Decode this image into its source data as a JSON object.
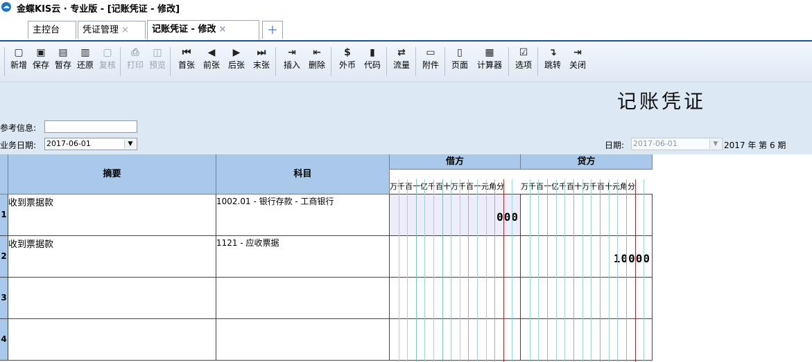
{
  "window": {
    "title": "金蝶KIS云 · 专业版 - [记账凭证 - 修改]"
  },
  "tabs": [
    {
      "label": "主控台",
      "closable": false
    },
    {
      "label": "凭证管理",
      "closable": true
    },
    {
      "label": "记账凭证 - 修改",
      "closable": true,
      "active": true
    }
  ],
  "tab_close_glyph": "×",
  "tab_add_glyph": "＋",
  "toolbar": [
    {
      "label": "新增",
      "icon": "new-icon",
      "glyph": "▢",
      "enabled": true
    },
    {
      "label": "保存",
      "icon": "save-icon",
      "glyph": "▣",
      "enabled": true
    },
    {
      "label": "暂存",
      "icon": "hold-icon",
      "glyph": "▤",
      "enabled": true
    },
    {
      "label": "还原",
      "icon": "restore-icon",
      "glyph": "▥",
      "enabled": true
    },
    {
      "label": "复核",
      "icon": "review-icon",
      "glyph": "▢",
      "enabled": false
    },
    {
      "label": "打印",
      "icon": "print-icon",
      "glyph": "⎙",
      "enabled": false
    },
    {
      "label": "预览",
      "icon": "preview-icon",
      "glyph": "◫",
      "enabled": false
    },
    {
      "label": "首张",
      "icon": "first-icon",
      "glyph": "⏮",
      "enabled": true
    },
    {
      "label": "前张",
      "icon": "prev-icon",
      "glyph": "◀",
      "enabled": true
    },
    {
      "label": "后张",
      "icon": "next-icon",
      "glyph": "▶",
      "enabled": true
    },
    {
      "label": "末张",
      "icon": "last-icon",
      "glyph": "⏭",
      "enabled": true
    },
    {
      "label": "插入",
      "icon": "insert-row-icon",
      "glyph": "⇥",
      "enabled": true
    },
    {
      "label": "删除",
      "icon": "delete-row-icon",
      "glyph": "⇤",
      "enabled": true
    },
    {
      "label": "外币",
      "icon": "currency-icon",
      "glyph": "$",
      "enabled": true
    },
    {
      "label": "代码",
      "icon": "code-icon",
      "glyph": "▮",
      "enabled": true
    },
    {
      "label": "流量",
      "icon": "cashflow-icon",
      "glyph": "⇄",
      "enabled": true
    },
    {
      "label": "附件",
      "icon": "attachment-icon",
      "glyph": "▭",
      "enabled": true
    },
    {
      "label": "页面",
      "icon": "page-icon",
      "glyph": "▯",
      "enabled": true
    },
    {
      "label": "计算器",
      "icon": "calculator-icon",
      "glyph": "▦",
      "enabled": true
    },
    {
      "label": "选项",
      "icon": "options-icon",
      "glyph": "☑",
      "enabled": true
    },
    {
      "label": "跳转",
      "icon": "jump-icon",
      "glyph": "↴",
      "enabled": true
    },
    {
      "label": "关闭",
      "icon": "close-icon",
      "glyph": "⇥",
      "enabled": true
    }
  ],
  "header": {
    "voucher_title": "记账凭证",
    "ref_label": "参考信息:",
    "ref_value": "",
    "biz_date_label": "业务日期:",
    "biz_date_value": "2017-06-01",
    "date_label": "日期:",
    "date_value": "2017-06-01",
    "period_text": "2017 年 第 6 期"
  },
  "grid": {
    "col_summary": "摘要",
    "col_account": "科目",
    "col_debit": "借方",
    "col_credit": "贷方",
    "digit_units": "万千百十亿千百十万千百十元角分",
    "rows": [
      {
        "no": "1",
        "summary": "收到票据款",
        "account": "1002.01 - 银行存款 - 工商银行",
        "debit": "000",
        "credit": ""
      },
      {
        "no": "2",
        "summary": "收到票据款",
        "account": "1121 - 应收票据",
        "debit": "",
        "credit": "10000"
      },
      {
        "no": "3",
        "summary": "",
        "account": "",
        "debit": "",
        "credit": ""
      },
      {
        "no": "4",
        "summary": "",
        "account": "",
        "debit": "",
        "credit": ""
      }
    ]
  },
  "colors": {
    "accent": "#1f4d94",
    "header_blue": "#aac8ea",
    "yuan_line": "#d42020",
    "digit_line": "#9fd4d4"
  }
}
